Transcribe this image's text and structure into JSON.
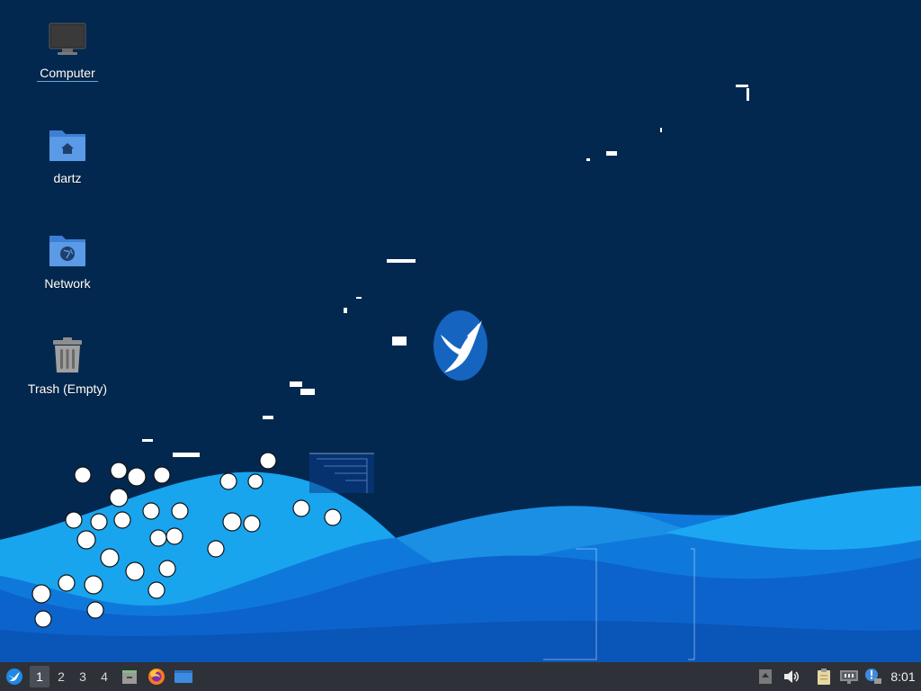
{
  "desktop": {
    "icons": [
      {
        "label": "Computer",
        "icon": "computer-icon"
      },
      {
        "label": "dartz",
        "icon": "home-folder-icon"
      },
      {
        "label": "Network",
        "icon": "network-folder-icon"
      },
      {
        "label": "Trash (Empty)",
        "icon": "trash-icon"
      }
    ],
    "selected_icon": "Computer"
  },
  "taskbar": {
    "menu_icon": "hummingbird-logo-icon",
    "workspaces": [
      "1",
      "2",
      "3",
      "4"
    ],
    "active_workspace": "1",
    "launchers": [
      {
        "icon": "file-manager-icon"
      },
      {
        "icon": "firefox-icon"
      },
      {
        "icon": "show-desktop-icon"
      }
    ],
    "tray": [
      {
        "icon": "updates-icon"
      },
      {
        "icon": "volume-icon"
      },
      {
        "icon": "clipboard-icon"
      },
      {
        "icon": "network-wired-icon"
      },
      {
        "icon": "notification-icon"
      }
    ],
    "clock": "8:01"
  },
  "colors": {
    "background": "#03284f",
    "wave_dark": "#0d61c8",
    "wave_mid": "#1a85e6",
    "wave_light": "#15a6f0",
    "panel": "#2e3238",
    "logo_blue": "#1565c0"
  }
}
